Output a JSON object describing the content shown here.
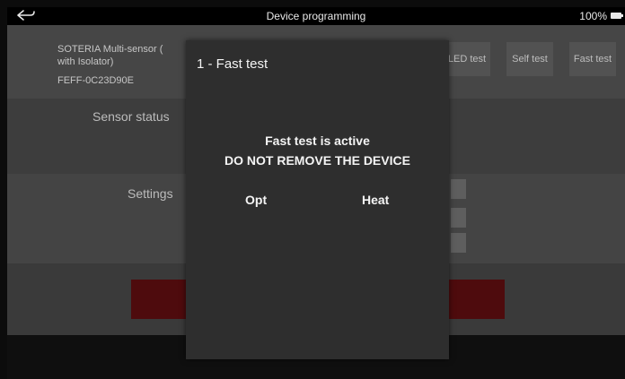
{
  "status_bar": {
    "title": "Device programming",
    "battery_level": "100%"
  },
  "device": {
    "name": "SOTERIA Multi-sensor (",
    "name_line2": "with Isolator)",
    "id": "FEFF-0C23D90E"
  },
  "test_buttons": [
    {
      "label": "LED test"
    },
    {
      "label": "Self test"
    },
    {
      "label": "Fast test"
    }
  ],
  "sections": {
    "sensor_status_label": "Sensor status",
    "settings_label": "Settings"
  },
  "dialog": {
    "title": "1 - Fast test",
    "message_line1": "Fast test is active",
    "message_line2": "DO NOT REMOVE THE DEVICE",
    "col_opt": "Opt",
    "col_heat": "Heat"
  },
  "colors": {
    "action_button": "#4e0b0d",
    "dialog_bg": "#2e2e2e"
  }
}
